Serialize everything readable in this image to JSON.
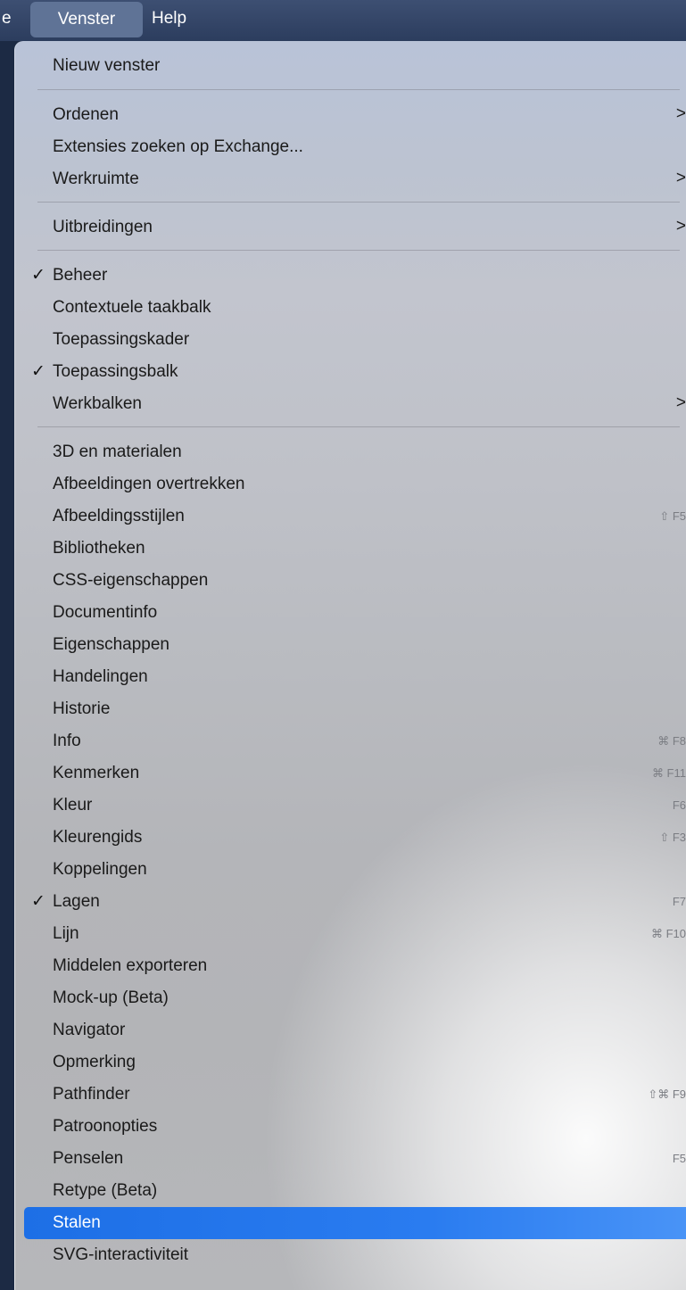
{
  "menubar": {
    "partial_left": "e",
    "active_menu": "Venster",
    "help": "Help"
  },
  "menu": {
    "nieuw_venster": "Nieuw venster",
    "ordenen": "Ordenen",
    "extensies": "Extensies zoeken op Exchange...",
    "werkruimte": "Werkruimte",
    "uitbreidingen": "Uitbreidingen",
    "beheer": "Beheer",
    "contextuele_taakbalk": "Contextuele taakbalk",
    "toepassingskader": "Toepassingskader",
    "toepassingsbalk": "Toepassingsbalk",
    "werkbalken": "Werkbalken",
    "panels": [
      {
        "label": "3D en materialen",
        "shortcut": ""
      },
      {
        "label": "Afbeeldingen overtrekken",
        "shortcut": ""
      },
      {
        "label": "Afbeeldingsstijlen",
        "shortcut": "⇧ F5"
      },
      {
        "label": "Bibliotheken",
        "shortcut": ""
      },
      {
        "label": "CSS-eigenschappen",
        "shortcut": ""
      },
      {
        "label": "Documentinfo",
        "shortcut": ""
      },
      {
        "label": "Eigenschappen",
        "shortcut": ""
      },
      {
        "label": "Handelingen",
        "shortcut": ""
      },
      {
        "label": "Historie",
        "shortcut": ""
      },
      {
        "label": "Info",
        "shortcut": "⌘ F8"
      },
      {
        "label": "Kenmerken",
        "shortcut": "⌘ F11"
      },
      {
        "label": "Kleur",
        "shortcut": "F6"
      },
      {
        "label": "Kleurengids",
        "shortcut": "⇧ F3"
      },
      {
        "label": "Koppelingen",
        "shortcut": ""
      },
      {
        "label": "Lagen",
        "shortcut": "F7",
        "checked": true
      },
      {
        "label": "Lijn",
        "shortcut": "⌘ F10"
      },
      {
        "label": "Middelen exporteren",
        "shortcut": ""
      },
      {
        "label": "Mock-up (Beta)",
        "shortcut": ""
      },
      {
        "label": "Navigator",
        "shortcut": ""
      },
      {
        "label": "Opmerking",
        "shortcut": ""
      },
      {
        "label": "Pathfinder",
        "shortcut": "⇧⌘ F9"
      },
      {
        "label": "Patroonopties",
        "shortcut": ""
      },
      {
        "label": "Penselen",
        "shortcut": "F5"
      },
      {
        "label": "Retype (Beta)",
        "shortcut": ""
      },
      {
        "label": "Stalen",
        "shortcut": "",
        "selected": true
      },
      {
        "label": "SVG-interactiviteit",
        "shortcut": ""
      }
    ],
    "check_glyph": "✓",
    "submenu_glyph": ">"
  },
  "colors": {
    "selection": "#2a7cf0",
    "menubar_active": "#5f7396"
  }
}
